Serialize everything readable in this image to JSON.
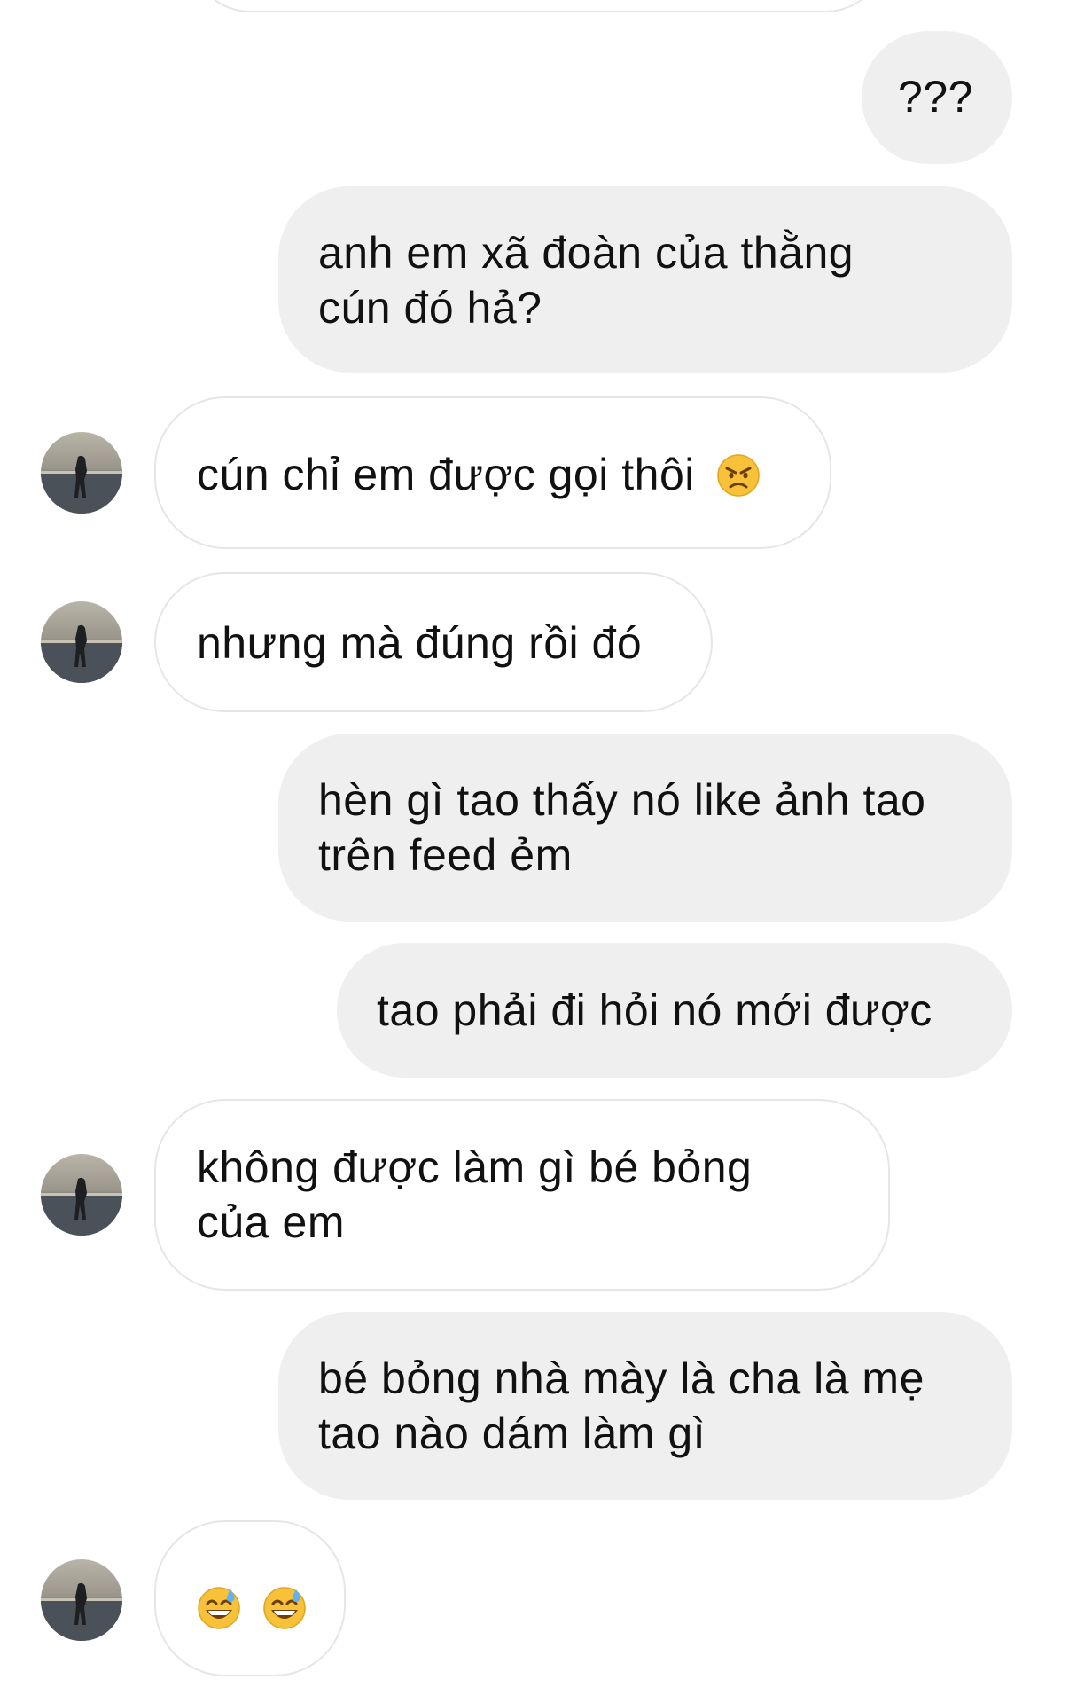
{
  "messages": [
    {
      "side": "out",
      "text": "???"
    },
    {
      "side": "out",
      "lines": [
        "anh em xã đoàn của thằng",
        "cún đó hả?"
      ]
    },
    {
      "side": "in",
      "text": "cún chỉ em được gọi thôi",
      "emoji": "angry-face"
    },
    {
      "side": "in",
      "text": "nhưng mà đúng rồi đó"
    },
    {
      "side": "out",
      "lines": [
        "hèn gì tao thấy nó like ảnh tao",
        "trên feed ẻm"
      ]
    },
    {
      "side": "out",
      "text": "tao phải đi hỏi nó mới được"
    },
    {
      "side": "in",
      "lines": [
        "không được làm gì bé bỏng",
        "của em"
      ]
    },
    {
      "side": "out",
      "lines": [
        "bé bỏng nhà mày là cha là mẹ",
        "tao nào dám làm gì"
      ]
    },
    {
      "side": "in",
      "emojis": [
        "grinning-sweat-face",
        "grinning-sweat-face"
      ]
    }
  ],
  "colors": {
    "outgoing_bubble": "#efefef",
    "incoming_border": "#e6e6e6",
    "emoji_yellow": "#f7c23a"
  }
}
